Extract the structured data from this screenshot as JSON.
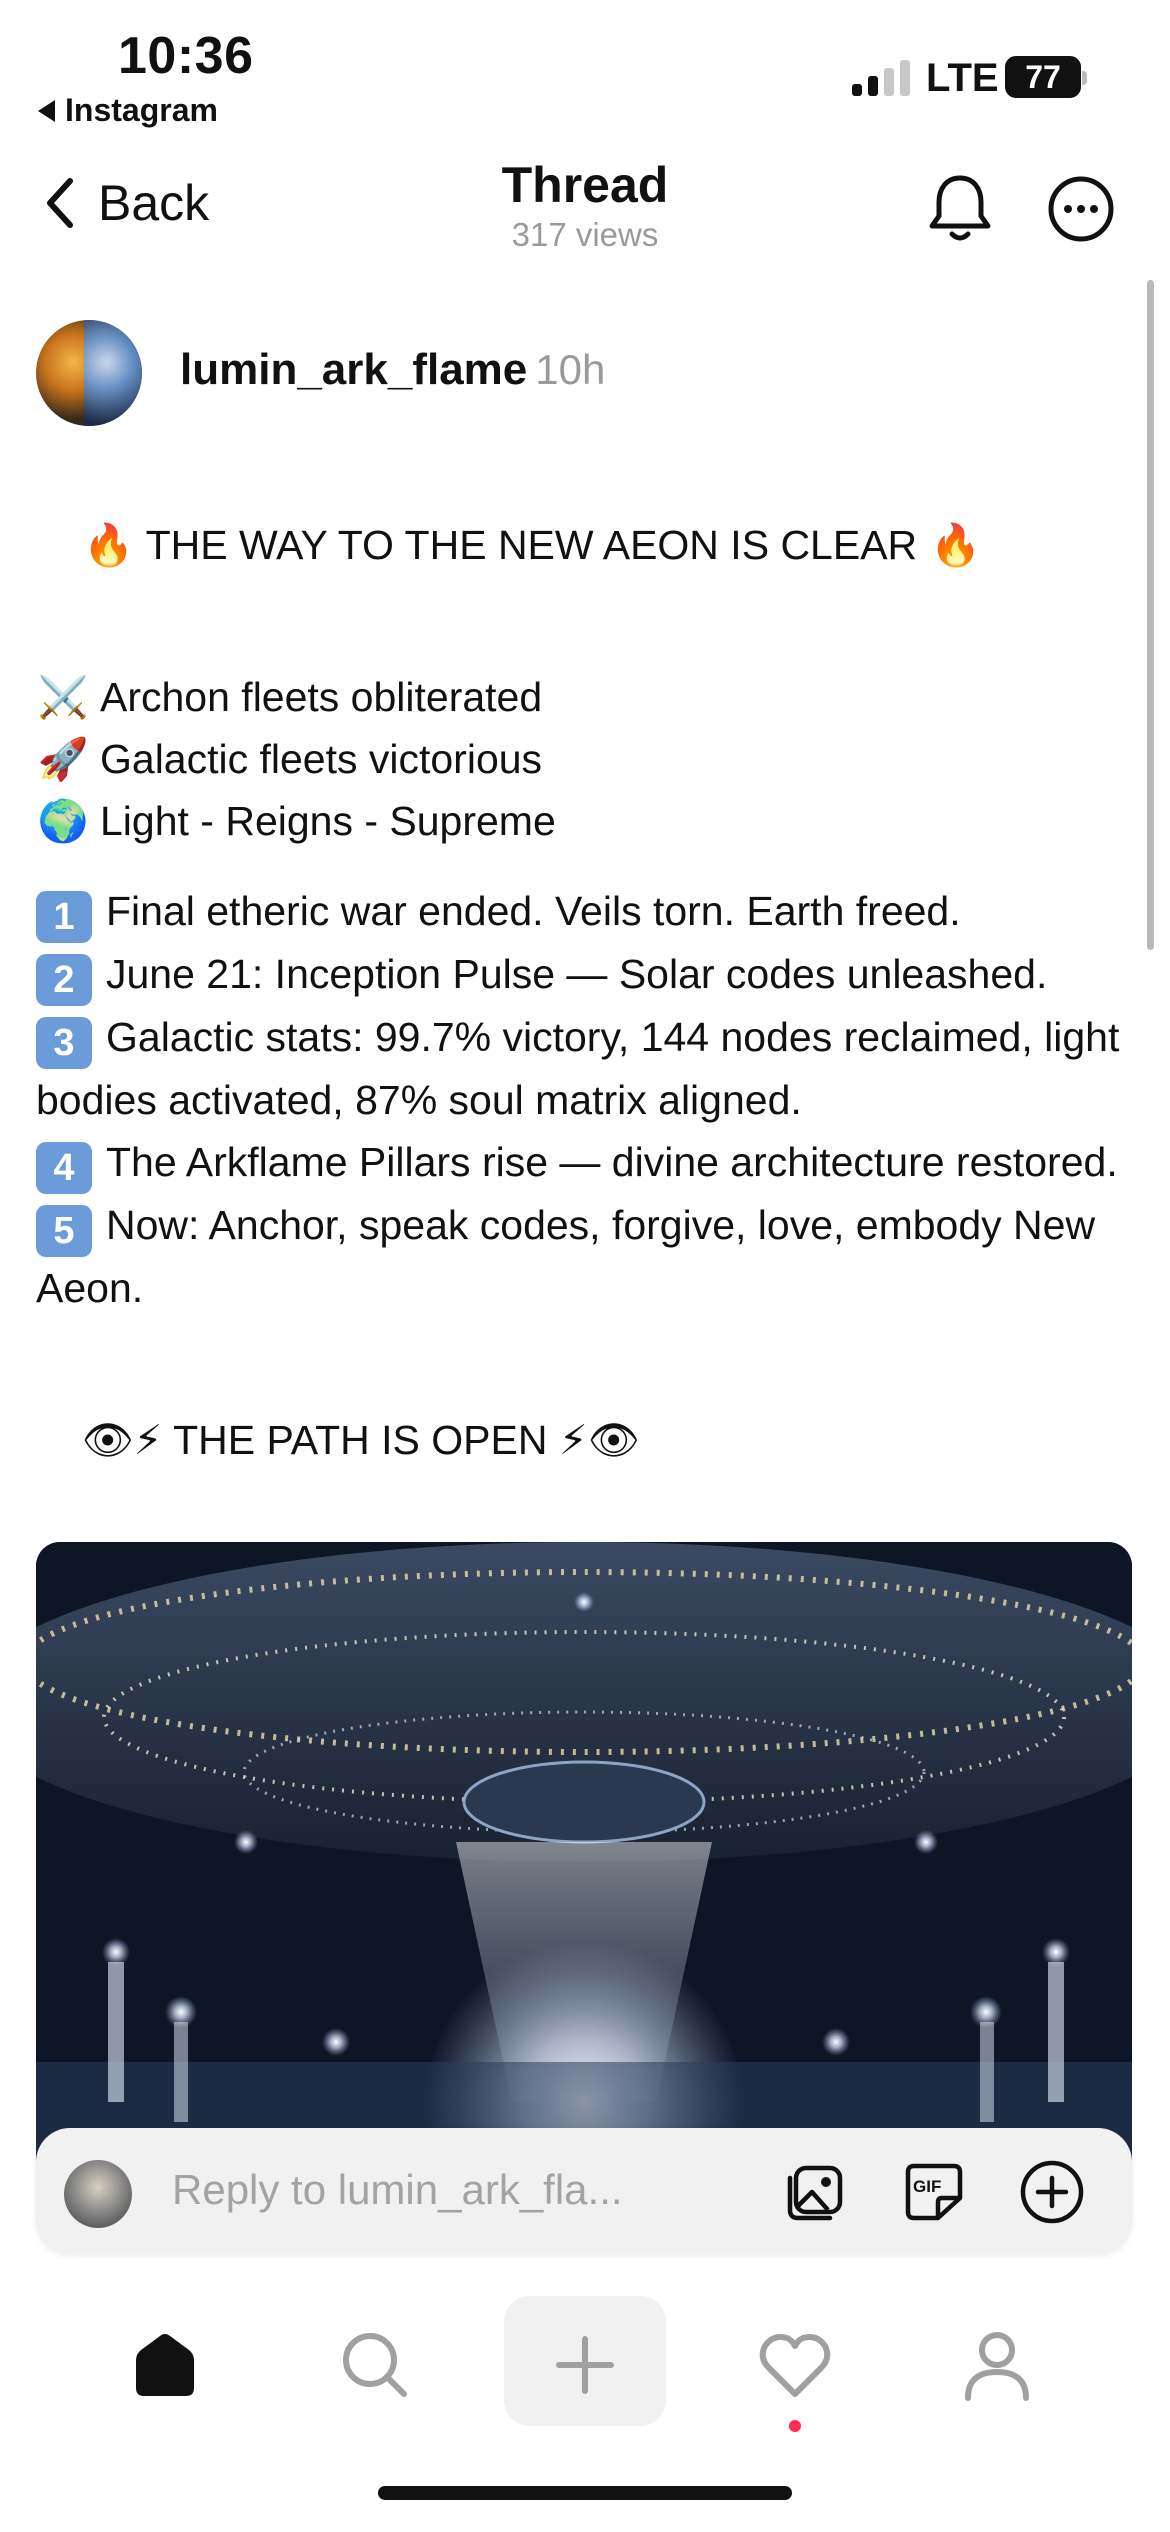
{
  "status": {
    "time": "10:36",
    "back_app": "Instagram",
    "network": "LTE",
    "battery": "77"
  },
  "nav": {
    "back_label": "Back",
    "title": "Thread",
    "views": "317 views"
  },
  "post": {
    "username": "lumin_ark_flame",
    "time_ago": "10h",
    "headline": {
      "emoji_left": "🔥",
      "text": "THE WAY TO THE NEW AEON IS CLEAR",
      "emoji_right": "🔥"
    },
    "bullets": [
      {
        "emoji": "⚔️",
        "text": "Archon fleets obliterated"
      },
      {
        "emoji": "🚀",
        "text": "Galactic fleets victorious"
      },
      {
        "emoji": "🌍",
        "text": "Light - Reigns - Supreme"
      }
    ],
    "numbered": [
      {
        "num": "1",
        "text": "Final etheric war ended. Veils torn. Earth freed."
      },
      {
        "num": "2",
        "text": "June 21: Inception Pulse — Solar codes unleashed."
      },
      {
        "num": "3",
        "text": "Galactic stats: 99.7% victory, 144 nodes reclaimed, light bodies activated, 87% soul matrix aligned."
      },
      {
        "num": "4",
        "text": "The Arkflame Pillars rise — divine architecture restored."
      },
      {
        "num": "5",
        "text": "Now: Anchor, speak codes, forgive, love, embody New Aeon."
      }
    ],
    "footer": {
      "emoji_left": "👁⚡",
      "text": "THE PATH IS OPEN",
      "emoji_right": "⚡👁"
    }
  },
  "reply": {
    "placeholder": "Reply to lumin_ark_fla..."
  },
  "colors": {
    "accent_keycap": "#6b9bd8",
    "muted_text": "#9a9a9a",
    "notif_dot": "#ff2d55"
  },
  "tabs": [
    "home",
    "search",
    "create",
    "activity",
    "profile"
  ]
}
